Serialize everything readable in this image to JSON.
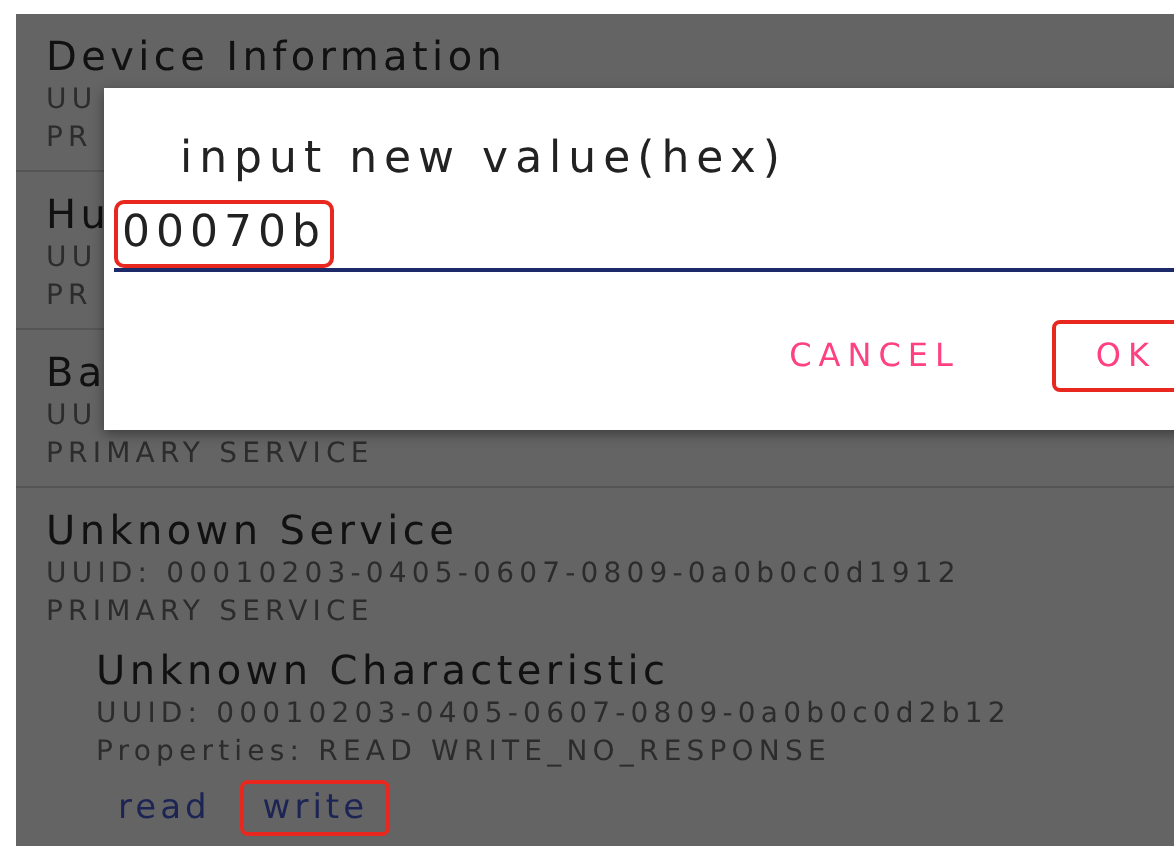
{
  "services": [
    {
      "name": "Device Information",
      "uuid": "UU",
      "type": "PR"
    },
    {
      "name": "Hu",
      "uuid": "UU",
      "type": "PR"
    },
    {
      "name": "Ba",
      "uuid": "UU",
      "type": "PRIMARY SERVICE"
    },
    {
      "name": "Unknown Service",
      "uuid": "UUID: 00010203-0405-0607-0809-0a0b0c0d1912",
      "type": "PRIMARY SERVICE",
      "characteristics": [
        {
          "name": "Unknown Characteristic",
          "uuid": "UUID: 00010203-0405-0607-0809-0a0b0c0d2b12",
          "properties": "Properties:  READ WRITE_NO_RESPONSE",
          "actions": [
            {
              "label": "read",
              "highlighted": false
            },
            {
              "label": "write",
              "highlighted": true
            }
          ]
        }
      ]
    }
  ],
  "dialog": {
    "title": "input new value(hex)",
    "value": "00070b",
    "value_highlighted": true,
    "buttons": [
      {
        "label": "CANCEL",
        "highlighted": false
      },
      {
        "label": "OK",
        "highlighted": true
      }
    ]
  }
}
